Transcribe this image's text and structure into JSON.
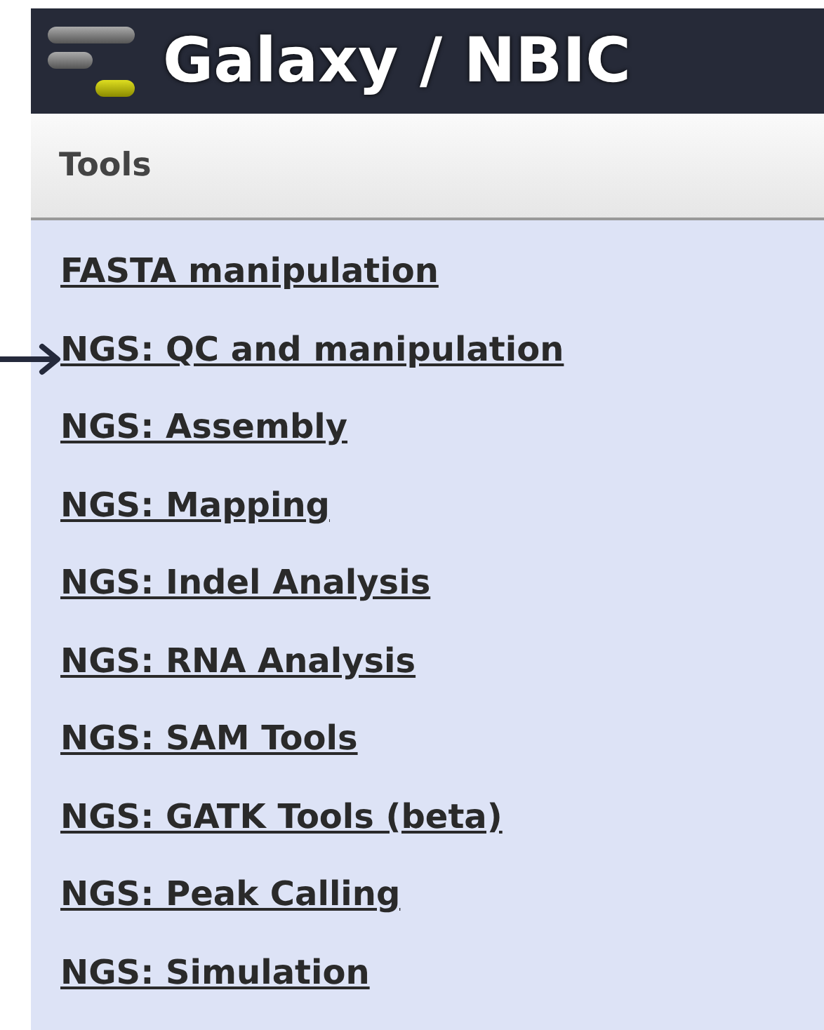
{
  "header": {
    "title": "Galaxy / NBIC"
  },
  "panel": {
    "title": "Tools"
  },
  "sections": [
    {
      "label": "FASTA manipulation",
      "marked": false
    },
    {
      "label": "NGS: QC and manipulation",
      "marked": true
    },
    {
      "label": "NGS: Assembly",
      "marked": false
    },
    {
      "label": "NGS: Mapping",
      "marked": false
    },
    {
      "label": "NGS: Indel Analysis",
      "marked": false
    },
    {
      "label": "NGS: RNA Analysis",
      "marked": false
    },
    {
      "label": "NGS: SAM Tools",
      "marked": false
    },
    {
      "label": "NGS: GATK Tools (beta)",
      "marked": false
    },
    {
      "label": "NGS: Peak Calling",
      "marked": false
    },
    {
      "label": "NGS: Simulation",
      "marked": false
    }
  ]
}
